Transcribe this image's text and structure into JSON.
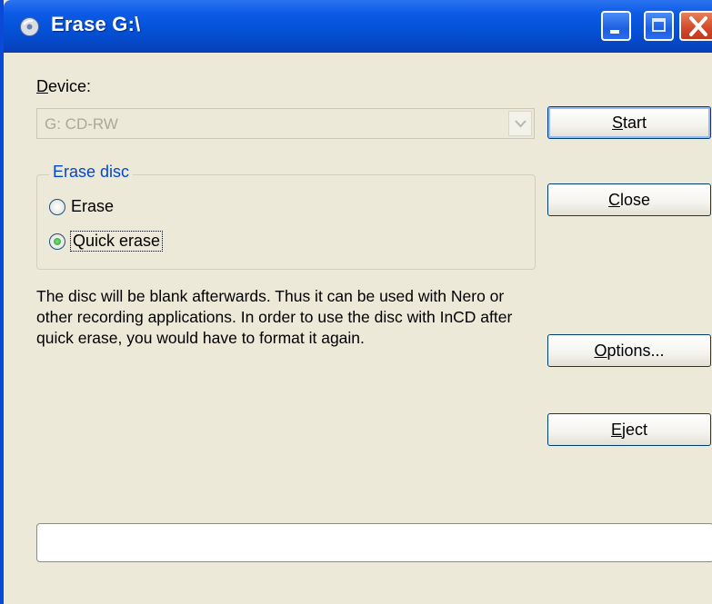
{
  "window": {
    "title": "Erase G:\\",
    "icon": "nero-disc-icon"
  },
  "titlebar_buttons": [
    "minimize-icon",
    "maximize-icon",
    "close-icon"
  ],
  "device": {
    "label_prefix": "",
    "label_accel": "D",
    "label_rest": "evice:",
    "selected": "G: CD-RW",
    "disabled": true
  },
  "erase_group": {
    "title": "Erase disc",
    "options": [
      {
        "label": "Erase",
        "checked": false
      },
      {
        "label": "Quick erase",
        "checked": true
      }
    ]
  },
  "description": "The disc will be blank afterwards. Thus it can be used with Nero or other recording applications. In order to use the disc with InCD after quick erase, you would have to format it again.",
  "buttons": {
    "start": {
      "accel": "S",
      "rest": "tart"
    },
    "close": {
      "accel": "C",
      "rest": "lose"
    },
    "options": {
      "accel": "O",
      "rest": "ptions..."
    },
    "eject": {
      "accel": "E",
      "rest": "ject"
    }
  },
  "progress": {
    "value": 0
  },
  "colors": {
    "titlebar": "#0452d8",
    "dialog_bg": "#ece9d8",
    "group_title": "#0046d5",
    "close_button": "#d2492a"
  }
}
